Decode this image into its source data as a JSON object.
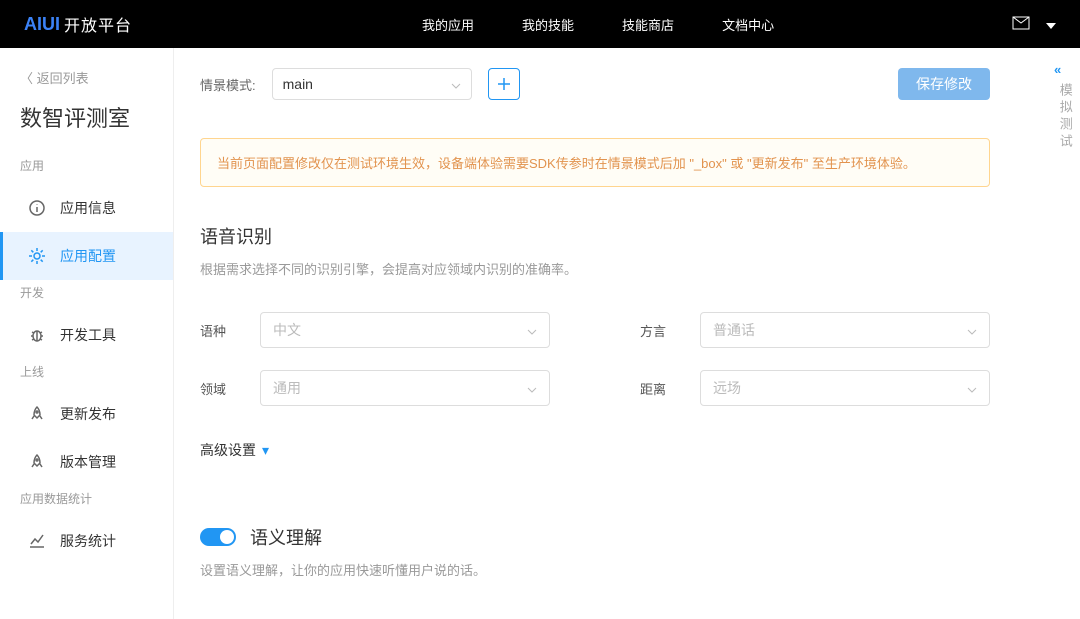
{
  "header": {
    "logo_platform": "开放平台",
    "nav": [
      "我的应用",
      "我的技能",
      "技能商店",
      "文档中心"
    ]
  },
  "sidebar": {
    "back": "〈 返回列表",
    "title": "数智评测室",
    "groups": [
      {
        "label": "应用",
        "items": [
          "应用信息",
          "应用配置"
        ]
      },
      {
        "label": "开发",
        "items": [
          "开发工具"
        ]
      },
      {
        "label": "上线",
        "items": [
          "更新发布",
          "版本管理"
        ]
      },
      {
        "label": "应用数据统计",
        "items": [
          "服务统计"
        ]
      }
    ]
  },
  "scene": {
    "label": "情景模式:",
    "value": "main",
    "save": "保存修改"
  },
  "notice": "当前页面配置修改仅在测试环境生效，设备端体验需要SDK传参时在情景模式后加 \"_box\" 或 \"更新发布\" 至生产环境体验。",
  "asr": {
    "title": "语音识别",
    "desc": "根据需求选择不同的识别引擎，会提高对应领域内识别的准确率。",
    "fields": {
      "language_label": "语种",
      "language_value": "中文",
      "dialect_label": "方言",
      "dialect_value": "普通话",
      "domain_label": "领域",
      "domain_value": "通用",
      "distance_label": "距离",
      "distance_value": "远场"
    },
    "advanced": "高级设置"
  },
  "nlu": {
    "title": "语义理解",
    "desc": "设置语义理解，让你的应用快速听懂用户说的话。"
  },
  "rail": "模拟测试"
}
